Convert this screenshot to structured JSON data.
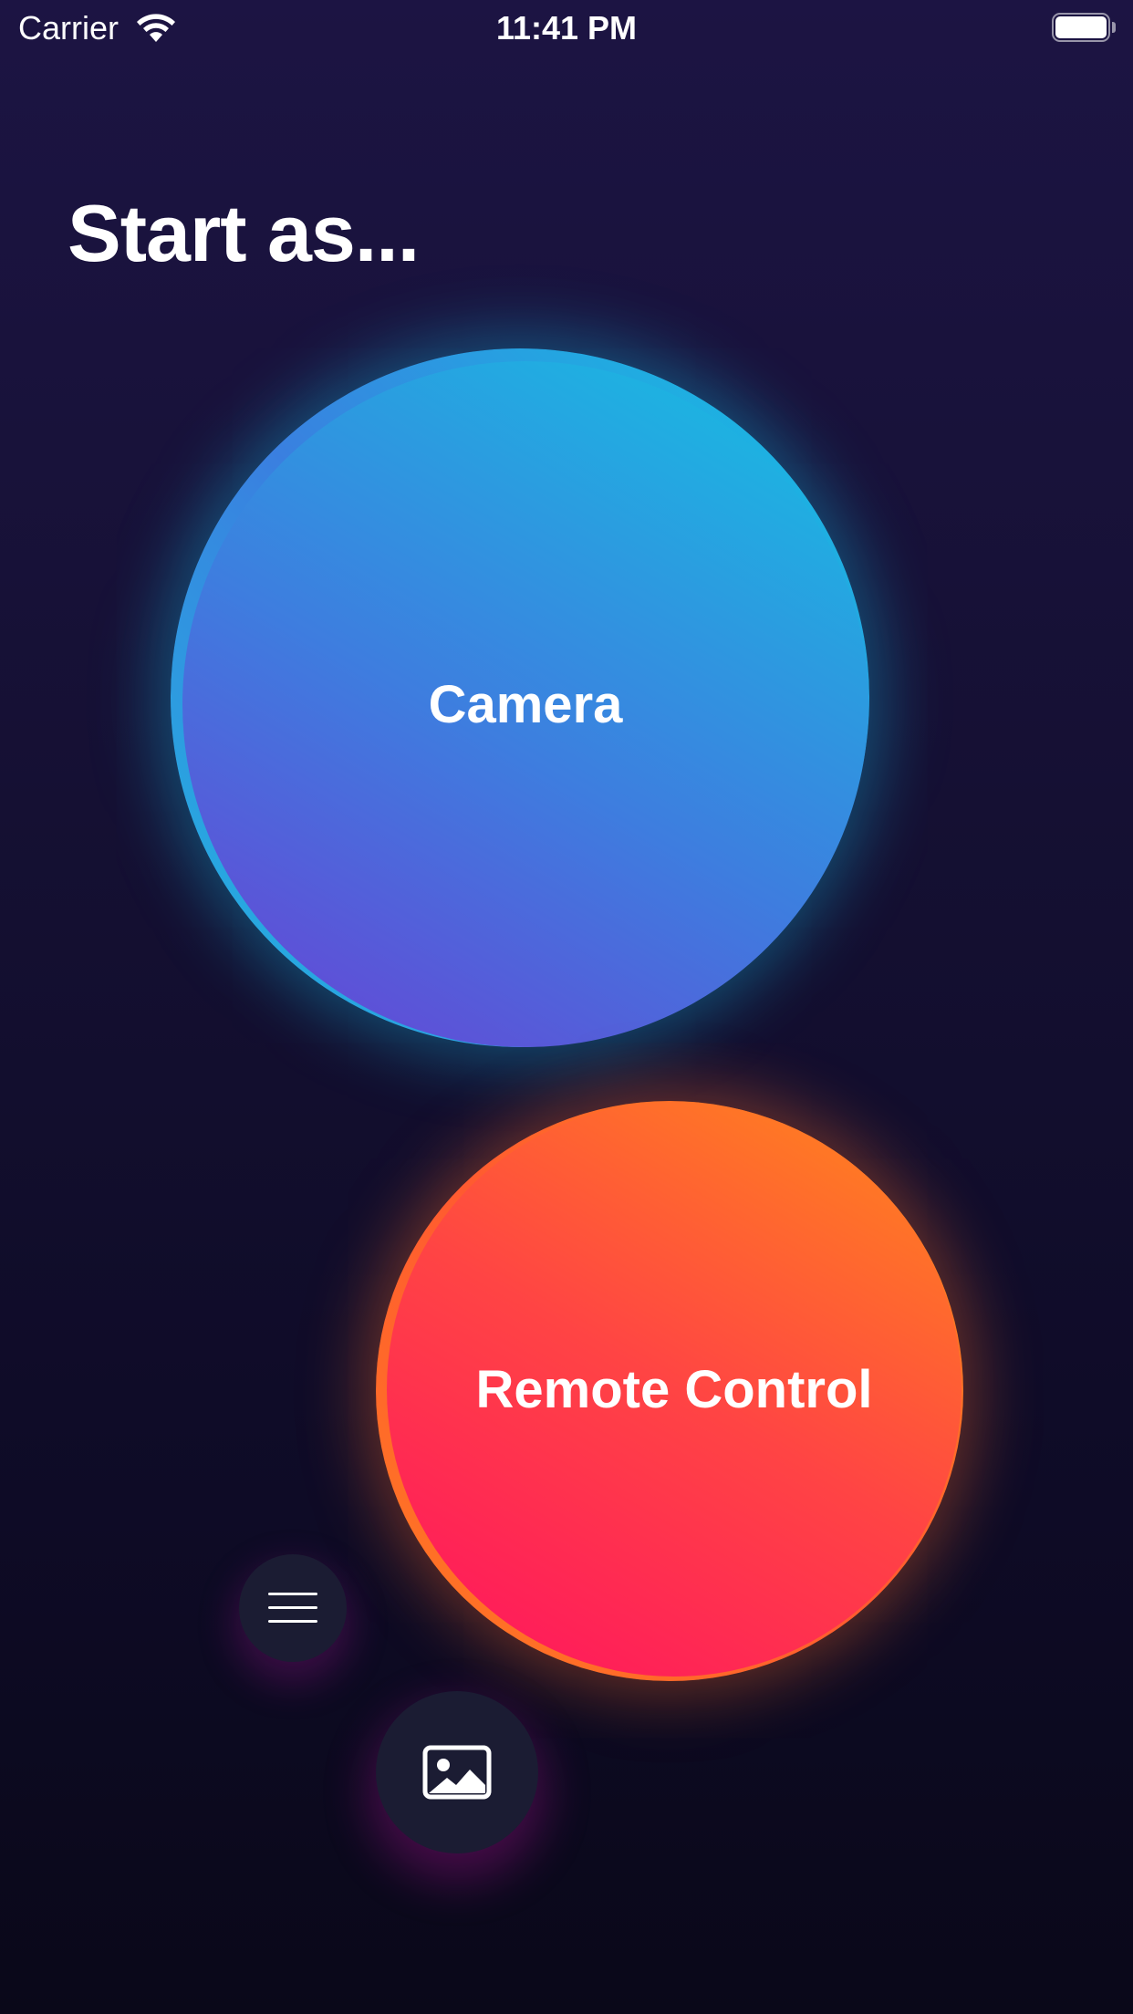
{
  "status_bar": {
    "carrier": "Carrier",
    "time": "11:41 PM",
    "wifi_icon": "wifi-icon",
    "battery_icon": "battery-full-icon"
  },
  "header": {
    "title": "Start as..."
  },
  "roles": {
    "camera": {
      "label": "Camera",
      "colors": [
        "#6a3fd4",
        "#3e7ddf",
        "#14c2e2"
      ]
    },
    "remote_control": {
      "label": "Remote Control",
      "colors": [
        "#ff1160",
        "#ff4444",
        "#ff8a1a"
      ]
    }
  },
  "actions": {
    "menu_icon": "hamburger-menu-icon",
    "gallery_icon": "image-icon"
  }
}
